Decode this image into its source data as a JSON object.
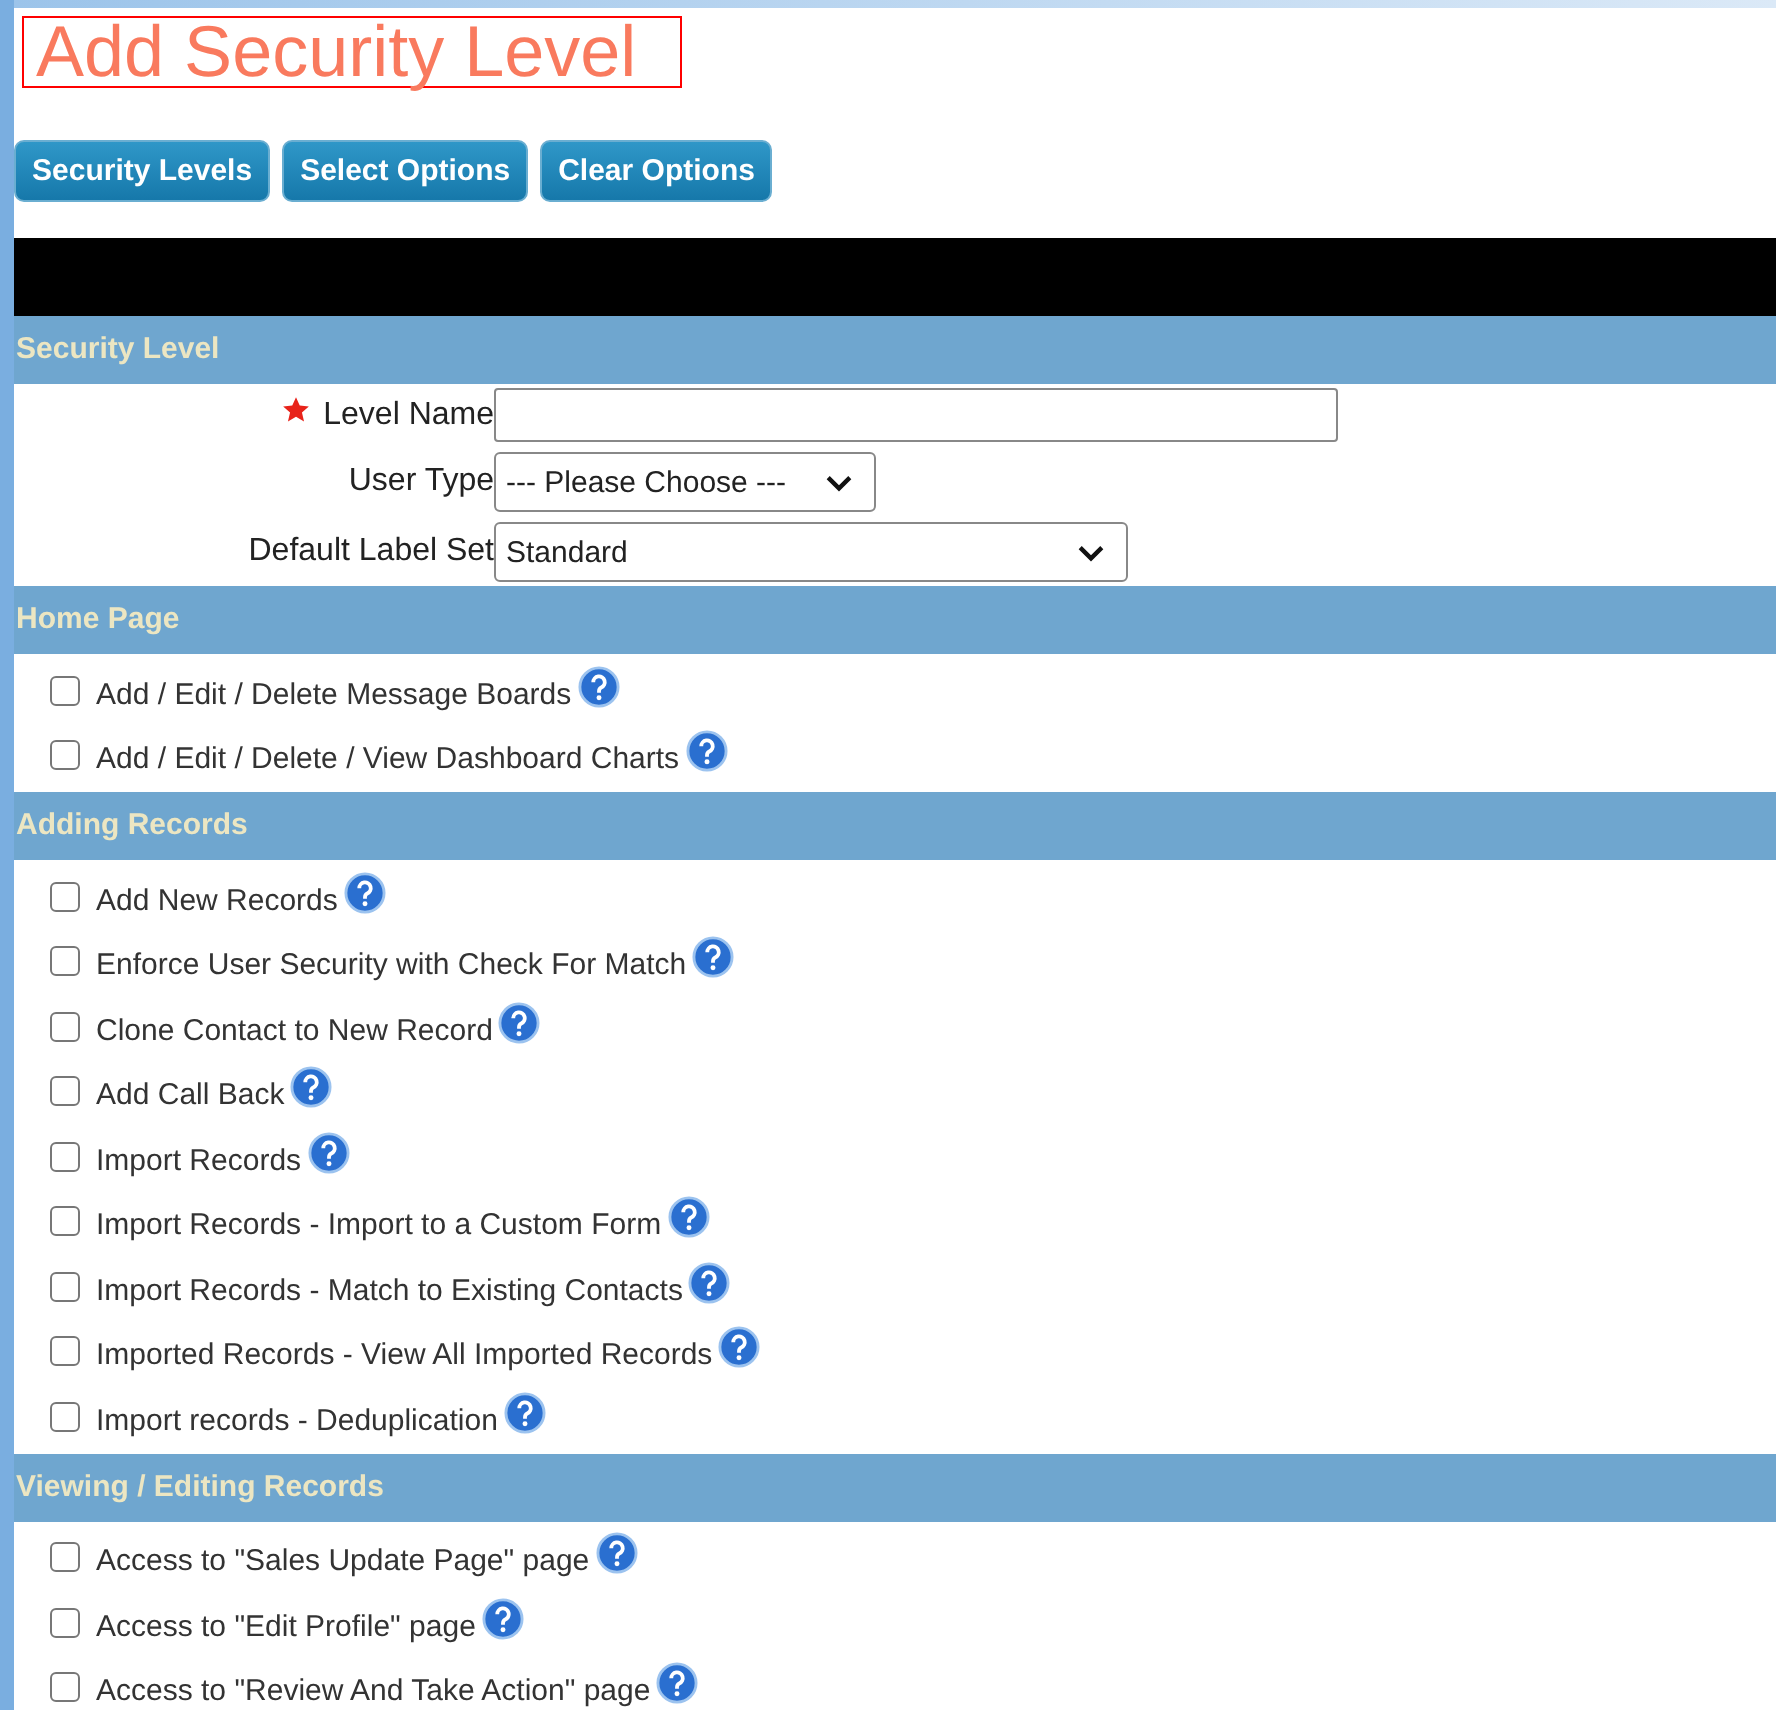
{
  "title": "Add Security Level",
  "buttons": [
    "Security Levels",
    "Select Options",
    "Clear Options"
  ],
  "form_section": {
    "header": "Security Level",
    "fields": [
      {
        "kind": "text",
        "label": "Level Name",
        "required": true
      },
      {
        "kind": "select",
        "label": "User Type",
        "required": false,
        "value": "--- Please Choose ---",
        "wide": false
      },
      {
        "kind": "select",
        "label": "Default Label Set",
        "required": false,
        "value": "Standard",
        "wide": true
      }
    ]
  },
  "sections": [
    {
      "header": "Home Page",
      "items": [
        {
          "label": "Add / Edit / Delete Message Boards",
          "checked": false
        },
        {
          "label": "Add / Edit / Delete / View Dashboard Charts",
          "checked": false
        }
      ]
    },
    {
      "header": "Adding Records",
      "items": [
        {
          "label": "Add New Records",
          "checked": false
        },
        {
          "label": "Enforce User Security with Check For Match",
          "checked": false
        },
        {
          "label": "Clone Contact to New Record",
          "checked": false
        },
        {
          "label": "Add Call Back",
          "checked": false
        },
        {
          "label": "Import Records",
          "checked": false
        },
        {
          "label": "Import Records - Import to a Custom Form",
          "checked": false
        },
        {
          "label": "Import Records - Match to Existing Contacts",
          "checked": false
        },
        {
          "label": "Imported Records - View All Imported Records",
          "checked": false
        },
        {
          "label": "Import records - Deduplication",
          "checked": false
        }
      ]
    },
    {
      "header": "Viewing / Editing Records",
      "items": [
        {
          "label": "Access to \"Sales Update Page\" page",
          "checked": false
        },
        {
          "label": "Access to \"Edit Profile\" page",
          "checked": false
        },
        {
          "label": "Access to \"Review And Take Action\" page",
          "checked": false
        }
      ]
    }
  ]
}
